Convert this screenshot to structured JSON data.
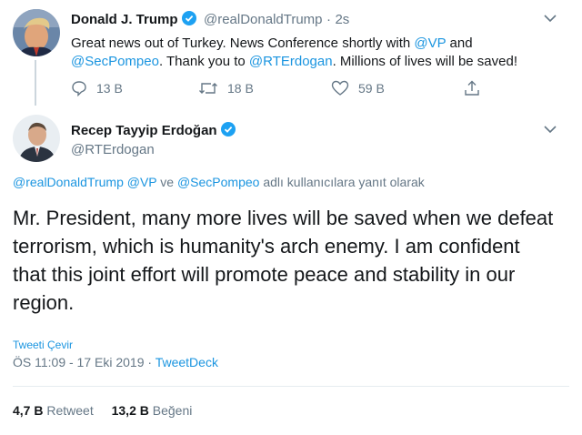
{
  "tweet1": {
    "name": "Donald J. Trump",
    "handle": "@realDonaldTrump",
    "sep": "·",
    "time": "2s",
    "text": {
      "p1": "Great news out of Turkey. News Conference shortly with ",
      "m1": "@VP",
      "p2": " and",
      "m2": "@SecPompeo",
      "p3": ". Thank you to ",
      "m3": "@RTErdogan",
      "p4": ". Millions of lives will be saved!"
    },
    "replies": "13 B",
    "retweets": "18 B",
    "likes": "59 B"
  },
  "tweet2": {
    "name": "Recep Tayyip Erdoğan",
    "handle": "@RTErdogan",
    "reply_to": {
      "m1": "@realDonaldTrump",
      "m2": "@VP",
      "conj": "ve",
      "m3": "@SecPompeo",
      "suffix": "adlı kullanıcılara yanıt olarak"
    },
    "text": "Mr. President, many more lives will be saved when we defeat terrorism, which is humanity's arch enemy. I am confident that this joint effort will promote peace and stability in our region.",
    "translate": "Tweeti Çevir",
    "timestamp": "ÖS 11:09 - 17 Eki 2019",
    "sep": "·",
    "source": "TweetDeck",
    "retweet_count": "4,7 B",
    "retweet_label": "Retweet",
    "like_count": "13,2 B",
    "like_label": "Beğeni"
  },
  "colors": {
    "link": "#1b95e0",
    "muted": "#657786",
    "verified": "#1da1f2"
  }
}
